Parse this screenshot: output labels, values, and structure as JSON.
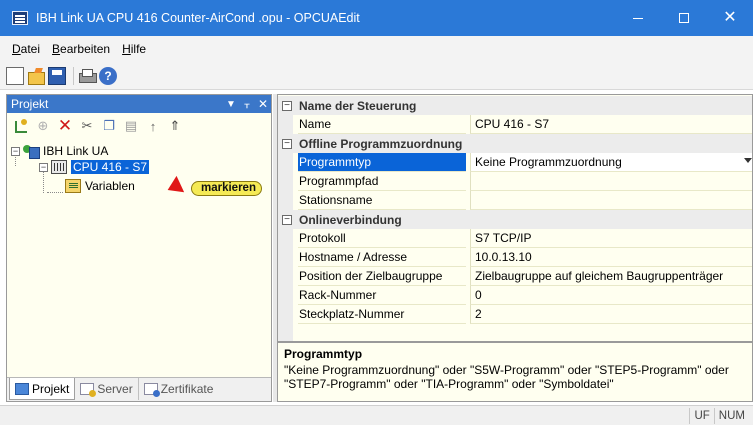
{
  "window": {
    "title": "IBH Link UA CPU 416 Counter-AirCond .opu - OPCUAEdit"
  },
  "menubar": {
    "items": [
      {
        "label": "Datei",
        "mnemonic": "D"
      },
      {
        "label": "Bearbeiten",
        "mnemonic": "B"
      },
      {
        "label": "Hilfe",
        "mnemonic": "H"
      }
    ]
  },
  "toolbar": {
    "icons": [
      "new-document-icon",
      "open-folder-icon",
      "save-icon",
      "print-icon",
      "help-icon"
    ]
  },
  "project_pane": {
    "title": "Projekt",
    "header_icons": [
      "dropdown-icon",
      "pin-icon",
      "close-icon"
    ],
    "toolbar_icons": [
      "new-project-icon",
      "new-item-icon",
      "delete-icon",
      "cut-icon",
      "copy-icon",
      "paste-icon",
      "move-up-icon",
      "move-down-icon"
    ],
    "tree": {
      "root": "IBH Link UA",
      "cpu": "CPU 416 - S7",
      "child": "Variablen"
    },
    "callout": "markieren",
    "tabs": [
      {
        "label": "Projekt",
        "active": true
      },
      {
        "label": "Server",
        "active": false
      },
      {
        "label": "Zertifikate",
        "active": false
      }
    ]
  },
  "properties": {
    "categories": [
      {
        "label": "Name der Steuerung",
        "rows": [
          {
            "name": "Name",
            "value": "CPU 416 - S7"
          }
        ]
      },
      {
        "label": "Offline Programmzuordnung",
        "rows": [
          {
            "name": "Programmtyp",
            "value": "Keine Programmzuordnung",
            "selected": true
          },
          {
            "name": "Programmpfad",
            "value": ""
          },
          {
            "name": "Stationsname",
            "value": ""
          }
        ]
      },
      {
        "label": "Onlineverbindung",
        "rows": [
          {
            "name": "Protokoll",
            "value": "S7 TCP/IP"
          },
          {
            "name": "Hostname / Adresse",
            "value": "10.0.13.10"
          },
          {
            "name": "Position der Zielbaugruppe",
            "value": "Zielbaugruppe auf gleichem Baugruppenträger"
          },
          {
            "name": "Rack-Nummer",
            "value": "0"
          },
          {
            "name": "Steckplatz-Nummer",
            "value": "2"
          }
        ]
      }
    ]
  },
  "description": {
    "title": "Programmtyp",
    "text": "\"Keine Programmzuordnung\" oder \"S5W-Programm\" oder \"STEP5-Programm\" oder \"STEP7-Programm\" oder \"TIA-Programm\" oder \"Symboldatei\""
  },
  "statusbar": {
    "cells": [
      "UF",
      "NUM"
    ]
  },
  "colors": {
    "titlebar": "#2b79d7",
    "selection": "#0a64d8",
    "pane_background": "#fffff0",
    "callout": "#f5ea55",
    "callout_arrow": "#e01818"
  }
}
